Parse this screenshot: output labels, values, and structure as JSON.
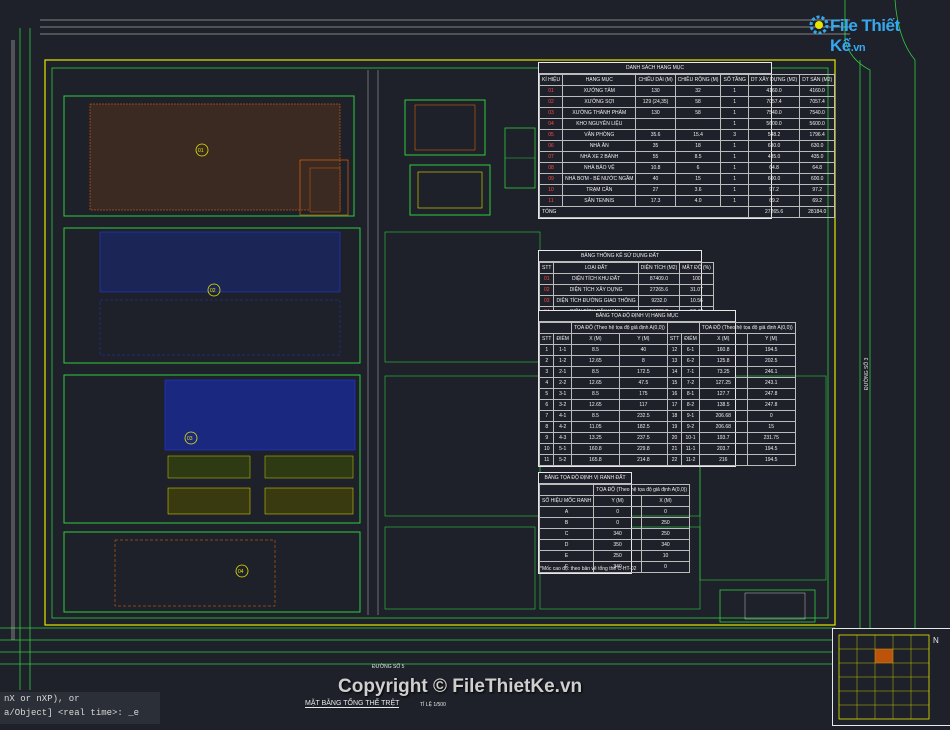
{
  "logo": {
    "text": "File Thiết Kế",
    "suffix": ".vn",
    "icon": "gear-icon"
  },
  "watermark": "Copyright © FileThietKe.vn",
  "command_line": [
    "nX or nXP), or",
    "a/Object] <real time>:  _e"
  ],
  "sheet_title": "MẶT BẰNG TỔNG THỂ TRỆT",
  "sheet_scale": "TỈ LỆ 1/500",
  "colors": {
    "background": "#1e2129",
    "boundary": "#e6e600",
    "grid": "#2ecc40",
    "building": "#ff6a00",
    "blue_zone": "#1e3cff",
    "table_line": "#e8e8e8"
  },
  "table_items": {
    "caption": "DANH SÁCH HẠNG MỤC",
    "headers": [
      "KÍ HIỆU",
      "HẠNG MỤC",
      "CHIỀU DÀI (M)",
      "CHIỀU RỘNG (M)",
      "SỐ TẦNG",
      "DT XÂY DỰNG (M2)",
      "DT SÀN (M2)"
    ],
    "rows": [
      [
        "01",
        "XƯỞNG TẨM",
        "130",
        "32",
        "1",
        "4160.0",
        "4160.0"
      ],
      [
        "02",
        "XƯỞNG SỢI",
        "129 (24,35)",
        "58",
        "1",
        "7057.4",
        "7057.4"
      ],
      [
        "03",
        "XƯỞNG THÀNH PHẨM",
        "130",
        "58",
        "1",
        "7540.0",
        "7540.0"
      ],
      [
        "04",
        "KHO NGUYÊN LIỆU",
        "",
        "",
        "1",
        "5600.0",
        "5600.0"
      ],
      [
        "05",
        "VĂN PHÒNG",
        "35.6",
        "15.4",
        "3",
        "548.2",
        "1796.4"
      ],
      [
        "06",
        "NHÀ ĂN",
        "35",
        "18",
        "1",
        "630.0",
        "630.0"
      ],
      [
        "07",
        "NHÀ XE 2 BÁNH",
        "55",
        "8.5",
        "1",
        "435.0",
        "435.0"
      ],
      [
        "08",
        "NHÀ BẢO VỆ",
        "10.8",
        "6",
        "1",
        "64.8",
        "64.8"
      ],
      [
        "09",
        "NHÀ BƠM - BỂ NƯỚC NGẦM",
        "40",
        "15",
        "1",
        "600.0",
        "600.0"
      ],
      [
        "10",
        "TRẠM CÂN",
        "27",
        "3.6",
        "1",
        "97.2",
        "97.2"
      ],
      [
        "11",
        "SÂN TENNIS",
        "17.3",
        "4.0",
        "1",
        "69.2",
        "69.2"
      ]
    ],
    "total": [
      "TỔNG",
      "27265.6",
      "28184.0"
    ]
  },
  "table_land": {
    "caption": "BẢNG THỐNG KÊ SỬ DỤNG ĐẤT",
    "headers": [
      "STT",
      "LOẠI ĐẤT",
      "DIỆN TÍCH (M2)",
      "MẬT ĐỘ (%)"
    ],
    "rows": [
      [
        "01",
        "DIỆN TÍCH KHU ĐẤT",
        "87409.0",
        "100"
      ],
      [
        "02",
        "DIỆN TÍCH XÂY DỰNG",
        "27265.6",
        "31.07"
      ],
      [
        "03",
        "DIỆN TÍCH ĐƯỜNG GIAO THÔNG",
        "9232.0",
        "10.56"
      ],
      [
        "04",
        "DIỆN TÍCH CÂY XANH",
        "50386.2",
        "57.47"
      ]
    ]
  },
  "table_coords": {
    "caption": "BẢNG TỌA ĐỘ ĐỊNH VỊ HẠNG MỤC",
    "group_left": "TỌA ĐỘ (Theo hệ tọa độ giả định A(0,0))",
    "group_right": "TỌA ĐỘ (Theo hệ tọa độ giả định A(0,0))",
    "headers": [
      "STT",
      "ĐIỂM",
      "X (M)",
      "Y (M)",
      "STT",
      "ĐIỂM",
      "X (M)",
      "Y (M)"
    ],
    "rows": [
      [
        "1",
        "1-1",
        "8.5",
        "40",
        "12",
        "6-1",
        "160.8",
        "194.5"
      ],
      [
        "2",
        "1-2",
        "12.65",
        "8",
        "13",
        "6-2",
        "125.8",
        "202.5"
      ],
      [
        "3",
        "2-1",
        "8.5",
        "172.5",
        "14",
        "7-1",
        "73.25",
        "246.1"
      ],
      [
        "4",
        "2-2",
        "12.65",
        "47.5",
        "15",
        "7-2",
        "127.25",
        "243.1"
      ],
      [
        "5",
        "3-1",
        "8.5",
        "175",
        "16",
        "8-1",
        "127.7",
        "247.8"
      ],
      [
        "6",
        "3-2",
        "12.65",
        "117",
        "17",
        "8-2",
        "138.5",
        "247.8"
      ],
      [
        "7",
        "4-1",
        "8.5",
        "232.5",
        "18",
        "9-1",
        "206.68",
        "0"
      ],
      [
        "8",
        "4-2",
        "11.05",
        "182.5",
        "19",
        "9-2",
        "206.68",
        "15"
      ],
      [
        "9",
        "4-3",
        "13.25",
        "237.5",
        "20",
        "10-1",
        "193.7",
        "231.75"
      ],
      [
        "10",
        "5-1",
        "160.8",
        "229.8",
        "21",
        "11-1",
        "203.7",
        "194.5"
      ],
      [
        "11",
        "5-2",
        "165.8",
        "214.8",
        "22",
        "11-2",
        "216",
        "194.5"
      ]
    ]
  },
  "table_boundary": {
    "caption": "BẢNG TỌA ĐỘ ĐỊNH VỊ RANH ĐẤT",
    "group": "TỌA ĐỘ (Theo hệ tọa độ giả định A(0,0))",
    "headers": [
      "SỐ HIỆU MỐC RANH",
      "Y (M)",
      "X (M)"
    ],
    "rows": [
      [
        "A",
        "0",
        "0"
      ],
      [
        "B",
        "0",
        "250"
      ],
      [
        "C",
        "340",
        "250"
      ],
      [
        "D",
        "350",
        "340"
      ],
      [
        "E",
        "250",
        "10"
      ],
      [
        "F",
        "340",
        "0"
      ]
    ]
  },
  "note": "*Mốc cao độ: theo bản vẽ tổng thể C-HT-02",
  "labels": {
    "block_labels": [
      "01",
      "02",
      "03",
      "04"
    ],
    "road_label": "ĐƯỜNG SỐ 5",
    "road_label_side": "ĐƯỜNG SỐ 3"
  }
}
